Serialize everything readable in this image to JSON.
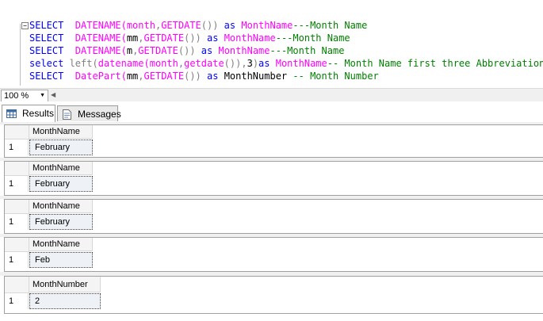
{
  "editor": {
    "lines": [
      [
        {
          "t": "SELECT  ",
          "c": "kw"
        },
        {
          "t": "DATENAME(",
          "c": "fn"
        },
        {
          "t": "month",
          "c": "fn"
        },
        {
          "t": ",",
          "c": "gr"
        },
        {
          "t": "GETDATE",
          "c": "fn"
        },
        {
          "t": "())",
          "c": "gr"
        },
        {
          "t": " as ",
          "c": "kw"
        },
        {
          "t": "MonthName",
          "c": "fn"
        },
        {
          "t": "---Month Name",
          "c": "cm"
        }
      ],
      [
        {
          "t": "SELECT  ",
          "c": "kw"
        },
        {
          "t": "DATENAME(",
          "c": "fn"
        },
        {
          "t": "mm",
          "c": "tx"
        },
        {
          "t": ",",
          "c": "gr"
        },
        {
          "t": "GETDATE",
          "c": "fn"
        },
        {
          "t": "())",
          "c": "gr"
        },
        {
          "t": " as ",
          "c": "kw"
        },
        {
          "t": "MonthName",
          "c": "fn"
        },
        {
          "t": "---Month Name",
          "c": "cm"
        }
      ],
      [
        {
          "t": "SELECT  ",
          "c": "kw"
        },
        {
          "t": "DATENAME(",
          "c": "fn"
        },
        {
          "t": "m",
          "c": "tx"
        },
        {
          "t": ",",
          "c": "gr"
        },
        {
          "t": "GETDATE",
          "c": "fn"
        },
        {
          "t": "())",
          "c": "gr"
        },
        {
          "t": " as ",
          "c": "kw"
        },
        {
          "t": "MonthName",
          "c": "fn"
        },
        {
          "t": "---Month Name",
          "c": "cm"
        }
      ],
      [
        {
          "t": "select ",
          "c": "kw"
        },
        {
          "t": "left(",
          "c": "gr"
        },
        {
          "t": "datename(",
          "c": "fn"
        },
        {
          "t": "month",
          "c": "fn"
        },
        {
          "t": ",",
          "c": "gr"
        },
        {
          "t": "getdate",
          "c": "fn"
        },
        {
          "t": "()),",
          "c": "gr"
        },
        {
          "t": "3",
          "c": "tx"
        },
        {
          "t": ")",
          "c": "gr"
        },
        {
          "t": "as ",
          "c": "kw"
        },
        {
          "t": "MonthName",
          "c": "fn"
        },
        {
          "t": "-- Month Name first three Abbreviation",
          "c": "cm"
        }
      ],
      [
        {
          "t": "SELECT  ",
          "c": "kw"
        },
        {
          "t": "DatePart(",
          "c": "fn"
        },
        {
          "t": "mm",
          "c": "tx"
        },
        {
          "t": ",",
          "c": "gr"
        },
        {
          "t": "GETDATE",
          "c": "fn"
        },
        {
          "t": "())",
          "c": "gr"
        },
        {
          "t": " as ",
          "c": "kw"
        },
        {
          "t": "MonthNumber",
          "c": "tx"
        },
        {
          "t": " -- Month Number",
          "c": "cm"
        }
      ]
    ]
  },
  "zoom": {
    "value": "100 %"
  },
  "tabs": {
    "results": "Results",
    "messages": "Messages"
  },
  "results": [
    {
      "column": "MonthName",
      "row": "1",
      "value": "February"
    },
    {
      "column": "MonthName",
      "row": "1",
      "value": "February"
    },
    {
      "column": "MonthName",
      "row": "1",
      "value": "February"
    },
    {
      "column": "MonthName",
      "row": "1",
      "value": "Feb"
    },
    {
      "column": "MonthNumber",
      "row": "1",
      "value": "2"
    }
  ]
}
